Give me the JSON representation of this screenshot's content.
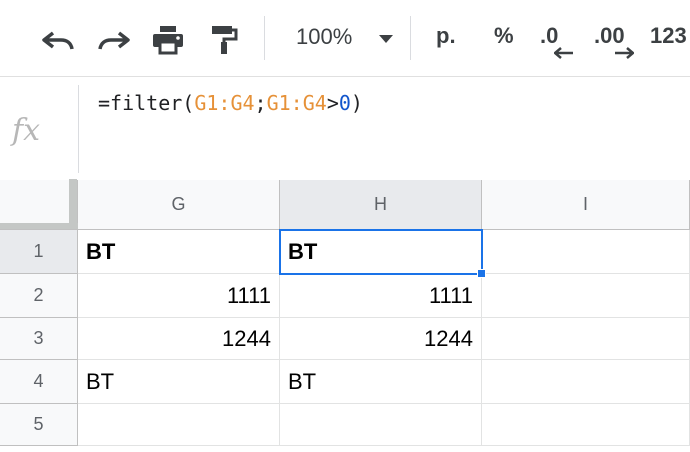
{
  "toolbar": {
    "undo_icon": "undo-icon",
    "redo_icon": "redo-icon",
    "print_icon": "print-icon",
    "paint_format_icon": "paint-format-icon",
    "zoom": "100%",
    "currency": "р.",
    "percent": "%",
    "decrease_decimal": ".0",
    "increase_decimal": ".00",
    "more_formats": "123"
  },
  "formula_bar": {
    "fx_label": "fx",
    "formula_parts": {
      "prefix": "=filter(",
      "range1": "G1:G4",
      "separator": ";",
      "range2": "G1:G4",
      "operator": ">",
      "number": "0",
      "suffix": ")"
    }
  },
  "columns": [
    {
      "label": "G"
    },
    {
      "label": "H"
    },
    {
      "label": "I"
    }
  ],
  "rows": [
    {
      "label": "1",
      "cells": [
        "BT",
        "BT",
        ""
      ]
    },
    {
      "label": "2",
      "cells": [
        "1111",
        "1111",
        ""
      ]
    },
    {
      "label": "3",
      "cells": [
        "1244",
        "1244",
        ""
      ]
    },
    {
      "label": "4",
      "cells": [
        "BT",
        "BT",
        ""
      ]
    },
    {
      "label": "5",
      "cells": [
        "",
        "",
        ""
      ]
    }
  ],
  "selection": {
    "cell": "H1"
  },
  "colors": {
    "selection": "#1a73e8",
    "formula_range": "#e69138",
    "formula_number": "#1155cc"
  }
}
